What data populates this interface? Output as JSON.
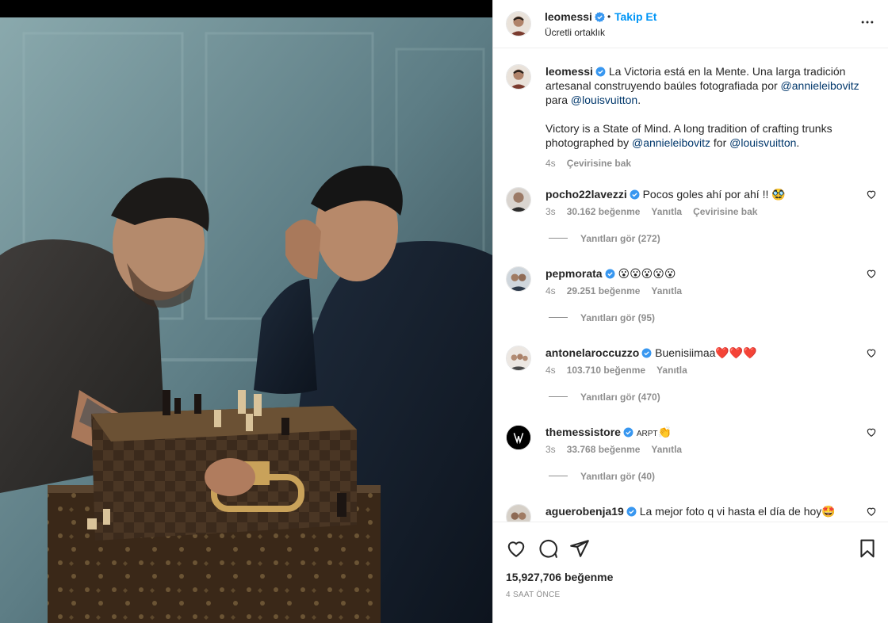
{
  "post": {
    "username": "leomessi",
    "follow_label": "Takip Et",
    "dot": "•",
    "subtitle": "Ücretli ortaklık",
    "more_icon": "more-horizontal-icon"
  },
  "caption": {
    "username": "leomessi",
    "text_es_1": "La Victoria está en la Mente. Una larga tradición artesanal construyendo baúles fotografiada por ",
    "mention_1": "@annieleibovitz",
    "text_es_2": " para ",
    "mention_2": "@louisvuitton",
    "text_es_3": ".",
    "text_en_1": "Victory is a State of Mind. A long tradition of crafting trunks photographed by ",
    "mention_3": "@annieleibovitz",
    "text_en_2": " for ",
    "mention_4": "@louisvuitton",
    "text_en_3": ".",
    "time": "4s",
    "translate": "Çevirisine bak"
  },
  "comments": [
    {
      "username": "pocho22lavezzi",
      "text": "Pocos goles ahí por ahí !! ",
      "emoji": "🥸",
      "time": "3s",
      "likes": "30.162 beğenme",
      "reply": "Yanıtla",
      "translate": "Çevirisine bak",
      "replies": "Yanıtları gör (272)"
    },
    {
      "username": "pepmorata",
      "text": "",
      "emoji": "😮😮😮😮😮",
      "time": "4s",
      "likes": "29.251 beğenme",
      "reply": "Yanıtla",
      "translate": "",
      "replies": "Yanıtları gör (95)"
    },
    {
      "username": "antonelaroccuzzo",
      "text": "Buenisiimaa",
      "emoji": "❤️❤️❤️",
      "time": "4s",
      "likes": "103.710 beğenme",
      "reply": "Yanıtla",
      "translate": "",
      "replies": "Yanıtları gör (470)"
    },
    {
      "username": "themessistore",
      "text": "ARPT",
      "emoji": "👏",
      "time": "3s",
      "likes": "33.768 beğenme",
      "reply": "Yanıtla",
      "translate": "",
      "replies": "Yanıtları gör (40)"
    },
    {
      "username": "aguerobenja19",
      "text": "La mejor foto q vi hasta el día de hoy",
      "emoji": "🤩",
      "time": "",
      "likes": "",
      "reply": "",
      "translate": "",
      "replies": ""
    }
  ],
  "actions": {
    "like_icon": "heart-icon",
    "comment_icon": "comment-icon",
    "share_icon": "share-icon",
    "save_icon": "bookmark-icon",
    "likes_count": "15,927,706 beğenme",
    "time_ago": "4 SAAT ÖNCE"
  },
  "colors": {
    "accent": "#0095f6",
    "mention": "#00376b",
    "verified": "#3897f0",
    "muted": "#8e8e8e"
  }
}
